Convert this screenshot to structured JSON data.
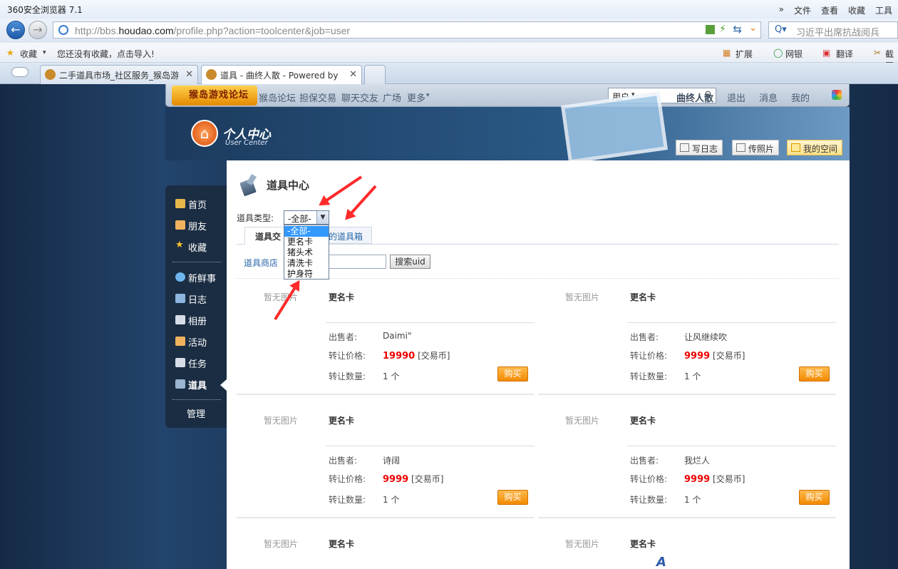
{
  "browser": {
    "title": "360安全浏览器 7.1",
    "menus": [
      "»",
      "文件",
      "查看",
      "收藏",
      "工具"
    ],
    "url_prefix": "http://bbs.",
    "url_domain": "houdao.com",
    "url_rest": "/profile.php?action=toolcenter&job=user",
    "search_text": "习近平出席抗战阅兵",
    "bookmarks_label": "收藏",
    "bookmarks_hint": "您还没有收藏，点击导入!",
    "ext_items": [
      "扩展",
      "网银",
      "翻译",
      "截图"
    ],
    "tabs": [
      {
        "label": "二手道具市场_社区服务_猴岛游",
        "active": false
      },
      {
        "label": "道具 - 曲终人散 - Powered by",
        "active": true
      }
    ]
  },
  "forum": {
    "logo": "猴岛游戏论坛",
    "nav": [
      "猴岛论坛",
      "担保交易",
      "聊天交友",
      "广场",
      "更多"
    ],
    "user_select": "用户",
    "right": [
      "曲终人散",
      "退出",
      "消息",
      "我的"
    ]
  },
  "usercenter": {
    "title": "个人中心",
    "subtitle": "User Center"
  },
  "quick_buttons": [
    "写日志",
    "传照片",
    "我的空间"
  ],
  "sidebar": [
    "首页",
    "朋友",
    "收藏",
    "新鲜事",
    "日志",
    "相册",
    "活动",
    "任务",
    "道具",
    "管理"
  ],
  "main": {
    "title": "道具中心",
    "type_label": "道具类型:",
    "type_value": "-全部-",
    "options": [
      "-全部-",
      "更名卡",
      "猪头术",
      "清洗卡",
      "护身符"
    ],
    "tabs": [
      "道具交",
      "的道具箱"
    ],
    "shop_link": "道具商店",
    "search_button": "搜索uid"
  },
  "labels": {
    "seller": "出售者:",
    "price": "转让价格:",
    "qty": "转让数量:",
    "currency": "[交易币]",
    "no_image": "暂无图片",
    "buy": "购买"
  },
  "items": [
    {
      "name": "更名卡",
      "seller": "Daimi\"",
      "price": "19990",
      "qty": "1 个"
    },
    {
      "name": "更名卡",
      "seller": "让风继续吹",
      "price": "9999",
      "qty": "1 个"
    },
    {
      "name": "更名卡",
      "seller": "诗阔",
      "price": "9999",
      "qty": "1 个"
    },
    {
      "name": "更名卡",
      "seller": "我烂人",
      "price": "9999",
      "qty": "1 个"
    },
    {
      "name": "更名卡"
    },
    {
      "name": "更名卡"
    }
  ],
  "colors": {
    "accent": "#ff2a2a",
    "buy": "#f28a00",
    "price": "#e00000",
    "link": "#2a66a8"
  }
}
